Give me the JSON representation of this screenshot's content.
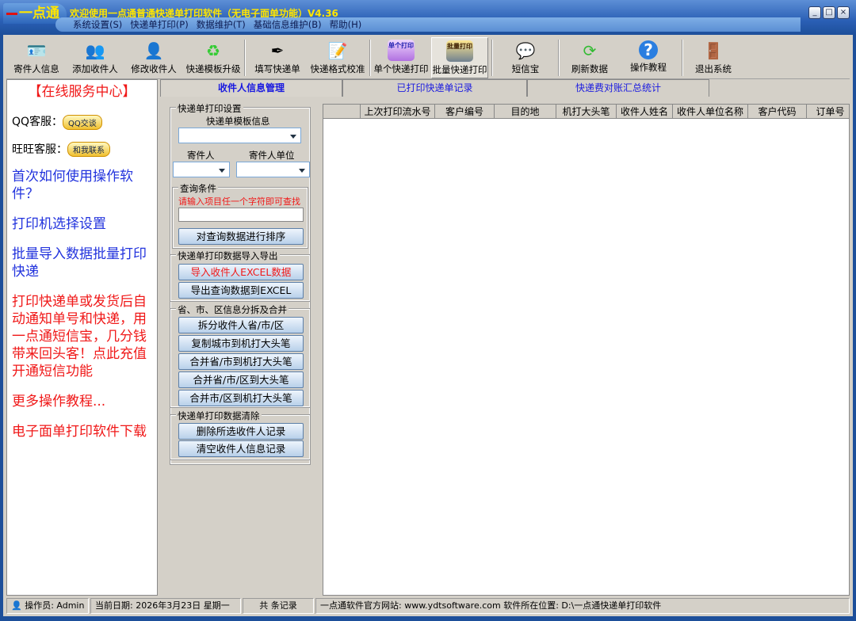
{
  "app": {
    "logo": "一点通",
    "title": "欢迎使用一点通普通快递单打印软件（无电子面单功能）V4.36"
  },
  "menu": [
    "系统设置(S)",
    "快递单打印(P)",
    "数据维护(T)",
    "基础信息维护(B)",
    "帮助(H)"
  ],
  "toolbar": [
    {
      "label": "寄件人信息",
      "icon": "sender-card-icon"
    },
    {
      "label": "添加收件人",
      "icon": "add-users-icon"
    },
    {
      "label": "修改收件人",
      "icon": "edit-user-icon"
    },
    {
      "label": "快递模板升级",
      "icon": "recycle-icon"
    },
    {
      "label": "填写快递单",
      "icon": "pen-icon"
    },
    {
      "label": "快递格式校准",
      "icon": "document-edit-icon"
    },
    {
      "label": "单个快递打印",
      "icon": "printer-icon",
      "badge": "单个打印"
    },
    {
      "label": "批量快递打印",
      "icon": "batch-printer-icon",
      "badge": "批量打印"
    },
    {
      "label": "短信宝",
      "icon": "sms-icon"
    },
    {
      "label": "刷新数据",
      "icon": "refresh-icon"
    },
    {
      "label": "操作教程",
      "icon": "help-icon"
    },
    {
      "label": "退出系统",
      "icon": "exit-door-icon"
    }
  ],
  "left": {
    "service_title": "【在线服务中心】",
    "qq_label": "QQ客服：",
    "qq_badge": "QQ交谈",
    "ww_label": "旺旺客服：",
    "ww_badge": "和我联系",
    "links": [
      {
        "text": "首次如何使用操作软件？",
        "color": "blue"
      },
      {
        "text": "打印机选择设置",
        "color": "blue"
      },
      {
        "text": "批量导入数据批量打印快递",
        "color": "blue"
      },
      {
        "text": "打印快递单或发货后自动通知单号和快递，用一点通短信宝，几分钱带来回头客！点此充值开通短信功能",
        "color": "red"
      },
      {
        "text": "更多操作教程...",
        "color": "red"
      },
      {
        "text": "电子面单打印软件下载",
        "color": "red"
      }
    ]
  },
  "tabs": [
    "收件人信息管理",
    "已打印快递单记录",
    "快递费对账汇总统计"
  ],
  "mid": {
    "print_settings": "快递单打印设置",
    "template_label": "快递单模板信息",
    "sender_label": "寄件人",
    "sender_unit_label": "寄件人单位",
    "query_group": "查询条件",
    "query_hint": "请输入项目任一个字符即可查找",
    "sort_button": "对查询数据进行排序",
    "io_group": "快递单打印数据导入导出",
    "import_button": "导入收件人EXCEL数据",
    "export_button": "导出查询数据到EXCEL",
    "split_group": "省、市、区信息分拆及合并",
    "split_buttons": [
      "拆分收件人省/市/区",
      "复制城市到机打大头笔",
      "合并省/市到机打大头笔",
      "合并省/市/区到大头笔",
      "合并市/区到机打大头笔"
    ],
    "clear_group": "快递单打印数据清除",
    "delete_button": "删除所选收件人记录",
    "clear_button": "清空收件人信息记录"
  },
  "grid": {
    "columns": [
      "",
      "上次打印流水号",
      "客户编号",
      "目的地",
      "机打大头笔",
      "收件人姓名",
      "收件人单位名称",
      "客户代码",
      "订单号"
    ]
  },
  "status": {
    "operator": "操作员: Admin",
    "date": "当前日期: 2026年3月23日 星期一",
    "count": "共   条记录",
    "site": "一点通软件官方网站: www.ydtsoftware.com  软件所在位置: D:\\一点通快递单打印软件"
  }
}
